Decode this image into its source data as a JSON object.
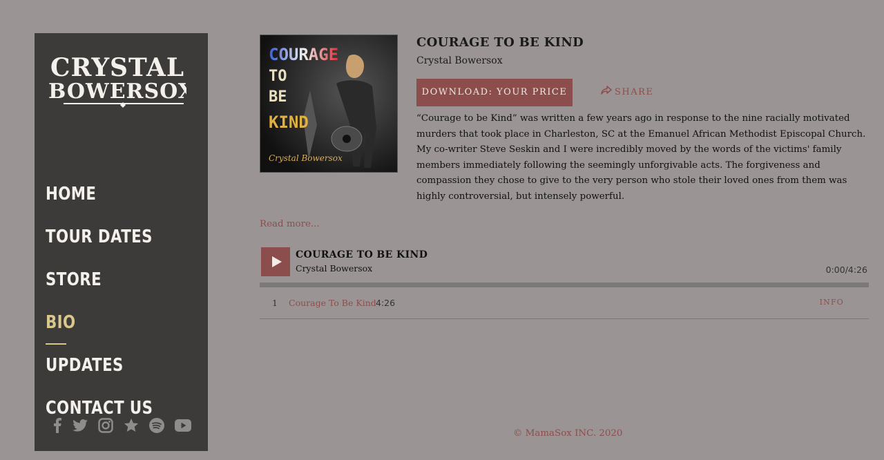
{
  "brand": {
    "logo_line1": "CRYSTAL",
    "logo_line2": "BOWERSOX"
  },
  "nav": {
    "items": [
      {
        "label": "HOME"
      },
      {
        "label": "TOUR DATES"
      },
      {
        "label": "STORE"
      },
      {
        "label": "BIO",
        "active": true
      },
      {
        "label": "UPDATES"
      },
      {
        "label": "CONTACT US"
      }
    ]
  },
  "social": [
    "facebook-icon",
    "twitter-icon",
    "instagram-icon",
    "star-icon",
    "spotify-icon",
    "youtube-icon"
  ],
  "album": {
    "title": "COURAGE TO BE KIND",
    "artist": "Crystal Bowersox",
    "art_text_words": [
      "COURAGE",
      "TO",
      "BE",
      "KIND"
    ],
    "art_signature": "Crystal Bowersox",
    "buy_label": "DOWNLOAD: YOUR PRICE",
    "share_label": "SHARE",
    "description": "“Courage to be Kind” was written a few years ago in response to the nine racially motivated murders that took place in Charleston, SC at the Emanuel African Methodist Episcopal Church. My co-writer Steve Seskin and I were incredibly moved by the words of the victims' family members immediately following the seemingly unforgivable acts. The forgiveness and compassion they chose to give to the very person who stole their loved ones from them was highly controversial, but intensely powerful.",
    "read_more": "Read more..."
  },
  "player": {
    "title": "COURAGE TO BE KIND",
    "artist": "Crystal Bowersox",
    "time": "0:00/4:26",
    "progress": 0
  },
  "tracks": [
    {
      "num": "1",
      "name": "Courage To Be Kind",
      "duration": "4:26",
      "info_label": "INFO"
    }
  ],
  "footer": {
    "text": "© MamaSox INC. 2020"
  },
  "colors": {
    "accent": "#8c4e4c",
    "sidebar": "#3d3a3a",
    "background": "#9a9494",
    "active_nav": "#d8c88c"
  }
}
